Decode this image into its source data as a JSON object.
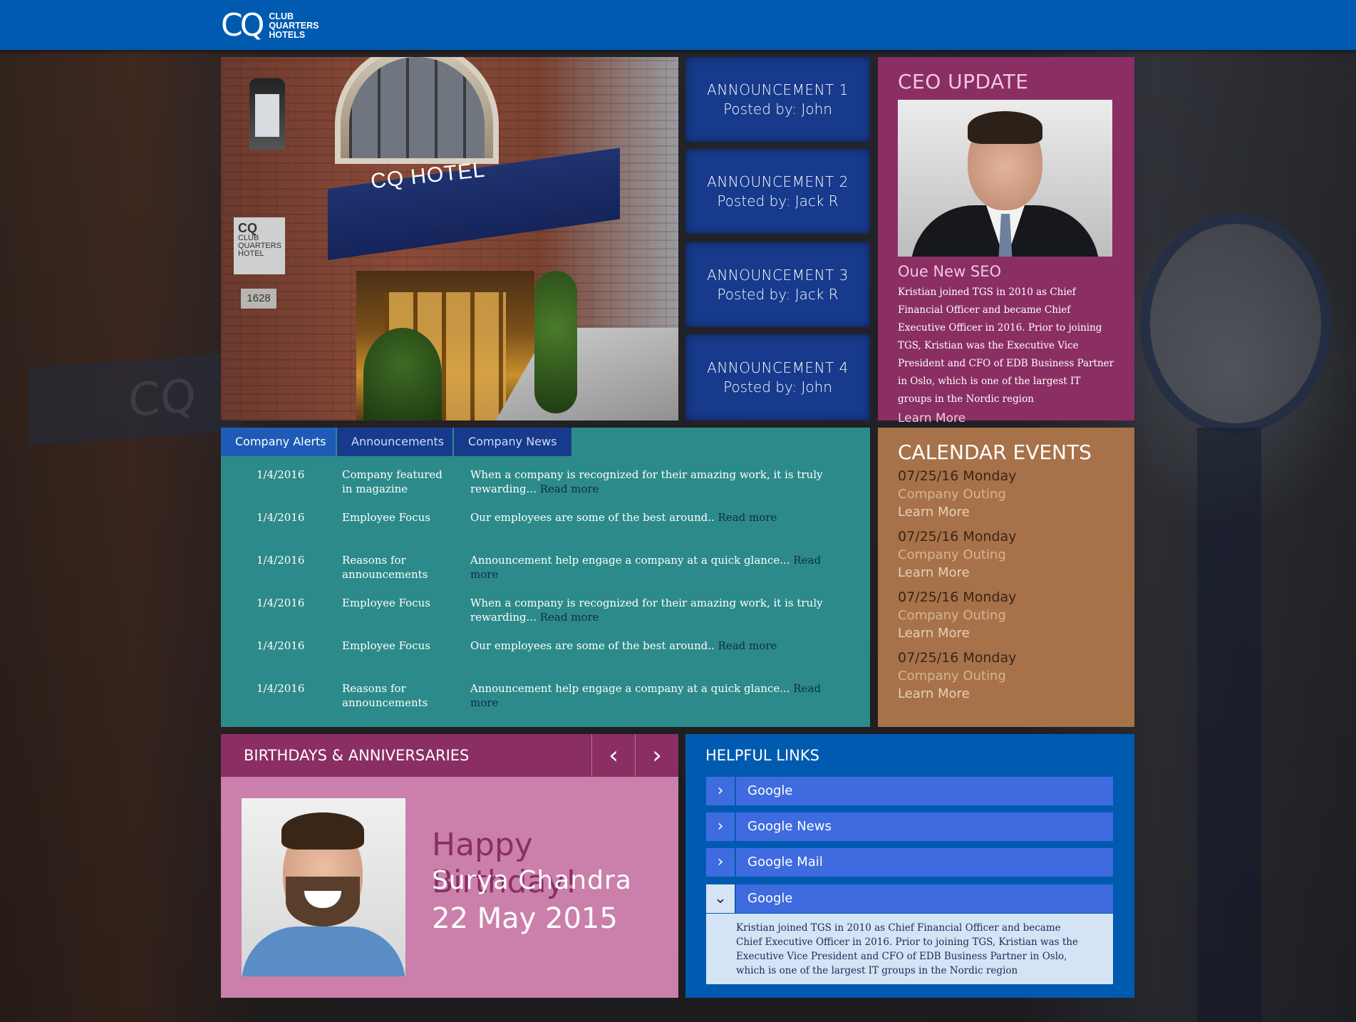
{
  "header": {
    "logo_mark": "CQ",
    "logo_lines": [
      "CLUB",
      "QUARTERS",
      "HOTELS"
    ]
  },
  "hero": {
    "awning_text": "CQ HOTEL",
    "sign_mark": "CQ",
    "sign_text": "CLUB QUARTERS HOTEL",
    "street_number": "1628"
  },
  "announcements": [
    {
      "title": "ANNOUNCEMENT 1",
      "posted": "Posted by: John"
    },
    {
      "title": "ANNOUNCEMENT 2",
      "posted": "Posted by: Jack R"
    },
    {
      "title": "ANNOUNCEMENT 3",
      "posted": "Posted by: Jack R"
    },
    {
      "title": "ANNOUNCEMENT 4",
      "posted": "Posted by: John"
    }
  ],
  "ceo": {
    "heading": "CEO UPDATE",
    "subheading": "Oue New SEO",
    "body": "Kristian joined TGS in 2010 as Chief Financial Officer and became Chief Executive Officer in 2016. Prior to joining TGS, Kristian was the Executive Vice President and CFO of EDB Business Partner in Oslo, which is one of the largest IT groups in the Nordic region",
    "link": "Learn More"
  },
  "news": {
    "tabs": [
      "Company Alerts",
      "Announcements",
      "Company News"
    ],
    "active_tab": 0,
    "read_more": "Read more",
    "rows": [
      {
        "date": "1/4/2016",
        "category": "Company featured in magazine",
        "text": "When a company is recognized for their amazing work, it is truly rewarding..."
      },
      {
        "date": "1/4/2016",
        "category": "Employee Focus",
        "text": "Our employees are some of the best around.."
      },
      {
        "date": "1/4/2016",
        "category": "Reasons for announcements",
        "text": "Announcement help engage a company at a quick glance..."
      },
      {
        "date": "1/4/2016",
        "category": "Employee Focus",
        "text": "When a company is recognized for their amazing work, it is truly rewarding..."
      },
      {
        "date": "1/4/2016",
        "category": "Employee Focus",
        "text": "Our employees are some of the best around.."
      },
      {
        "date": "1/4/2016",
        "category": "Reasons for announcements",
        "text": "Announcement help engage a company at a quick glance..."
      }
    ]
  },
  "calendar": {
    "heading": "CALENDAR EVENTS",
    "events": [
      {
        "date": "07/25/16 Monday",
        "name": "Company Outing",
        "link": "Learn More"
      },
      {
        "date": "07/25/16 Monday",
        "name": "Company Outing",
        "link": "Learn More"
      },
      {
        "date": "07/25/16 Monday",
        "name": "Company Outing",
        "link": "Learn More"
      },
      {
        "date": "07/25/16 Monday",
        "name": "Company Outing",
        "link": "Learn More"
      }
    ]
  },
  "birthday": {
    "heading": "BIRTHDAYS & ANNIVERSARIES",
    "prev_icon": "‹",
    "next_icon": "›",
    "greeting": "Happy Birthday!",
    "name": "Surya Chandra",
    "date": "22 May 2015"
  },
  "links": {
    "heading": "HELPFUL LINKS",
    "items": [
      {
        "label": "Google",
        "open": false
      },
      {
        "label": "Google News",
        "open": false
      },
      {
        "label": "Google Mail",
        "open": false
      },
      {
        "label": "Google",
        "open": true
      }
    ],
    "expanded_text": "Kristian joined TGS in 2010 as Chief Financial Officer and became Chief Executive Officer in 2016. Prior to joining TGS, Kristian was the Executive Vice President and CFO of EDB Business Partner in Oslo, which is one of the largest IT groups in the Nordic region"
  },
  "colors": {
    "header_blue": "#005bb0",
    "announcement_blue": "#173a8c",
    "ceo_plum": "#8a2e64",
    "news_teal": "#2d8a8a",
    "calendar_tan": "#a7724a",
    "birthday_pink": "#ca80aa",
    "link_blue": "#3f6be0"
  }
}
